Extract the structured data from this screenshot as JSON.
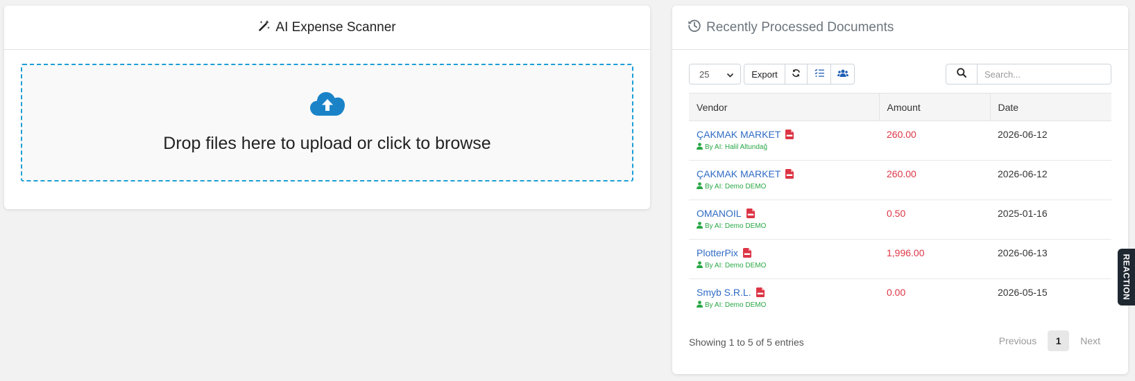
{
  "scanner": {
    "title": "AI Expense Scanner",
    "dropzone_text": "Drop files here to upload or click to browse"
  },
  "documents": {
    "title": "Recently Processed Documents",
    "page_size": "25",
    "export_label": "Export",
    "search_placeholder": "Search...",
    "columns": [
      "Vendor",
      "Amount",
      "Date"
    ],
    "rows": [
      {
        "vendor": "ÇAKMAK MARKET",
        "by": "By AI: Halil Altundağ",
        "amount": "260.00",
        "date": "2026-06-12"
      },
      {
        "vendor": "ÇAKMAK MARKET",
        "by": "By AI: Demo DEMO",
        "amount": "260.00",
        "date": "2026-06-12"
      },
      {
        "vendor": "OMANOIL",
        "by": "By AI: Demo DEMO",
        "amount": "0.50",
        "date": "2025-01-16"
      },
      {
        "vendor": "PlotterPix",
        "by": "By AI: Demo DEMO",
        "amount": "1,996.00",
        "date": "2026-06-13"
      },
      {
        "vendor": "Smyb S.R.L.",
        "by": "By AI: Demo DEMO",
        "amount": "0.00",
        "date": "2026-05-15"
      }
    ],
    "footer_info": "Showing 1 to 5 of 5 entries",
    "pagination": {
      "previous": "Previous",
      "current": "1",
      "next": "Next"
    }
  },
  "side_tab": {
    "label": "REACTION"
  },
  "icons": {
    "scanner_title": "magic-wand-icon",
    "docs_title": "history-icon",
    "upload": "cloud-upload-icon",
    "refresh": "refresh-icon",
    "columns": "list-check-icon",
    "users": "users-icon",
    "search": "search-icon",
    "pdf": "pdf-file-icon",
    "user": "user-icon"
  },
  "colors": {
    "accent": "#1a9ed6",
    "vendor_link": "#2f6bc4",
    "amount": "#dc3545",
    "ai_by": "#28a745",
    "side_tab_bg": "#1f2731"
  }
}
